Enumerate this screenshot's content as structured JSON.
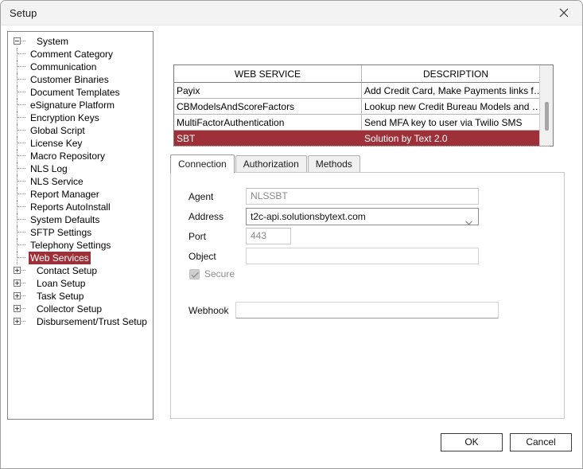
{
  "window": {
    "title": "Setup",
    "close_icon": "close-icon"
  },
  "tree": {
    "nodes": [
      {
        "label": "System",
        "level": 0,
        "expander": "minus",
        "selected": false
      },
      {
        "label": "Comment Category",
        "level": 1,
        "expander": "none",
        "selected": false
      },
      {
        "label": "Communication",
        "level": 1,
        "expander": "none",
        "selected": false
      },
      {
        "label": "Customer Binaries",
        "level": 1,
        "expander": "none",
        "selected": false
      },
      {
        "label": "Document Templates",
        "level": 1,
        "expander": "none",
        "selected": false
      },
      {
        "label": "eSignature Platform",
        "level": 1,
        "expander": "none",
        "selected": false
      },
      {
        "label": "Encryption Keys",
        "level": 1,
        "expander": "none",
        "selected": false
      },
      {
        "label": "Global Script",
        "level": 1,
        "expander": "none",
        "selected": false
      },
      {
        "label": "License Key",
        "level": 1,
        "expander": "none",
        "selected": false
      },
      {
        "label": "Macro Repository",
        "level": 1,
        "expander": "none",
        "selected": false
      },
      {
        "label": "NLS Log",
        "level": 1,
        "expander": "none",
        "selected": false
      },
      {
        "label": "NLS Service",
        "level": 1,
        "expander": "none",
        "selected": false
      },
      {
        "label": "Report Manager",
        "level": 1,
        "expander": "none",
        "selected": false
      },
      {
        "label": "Reports AutoInstall",
        "level": 1,
        "expander": "none",
        "selected": false
      },
      {
        "label": "System Defaults",
        "level": 1,
        "expander": "none",
        "selected": false
      },
      {
        "label": "SFTP Settings",
        "level": 1,
        "expander": "none",
        "selected": false
      },
      {
        "label": "Telephony Settings",
        "level": 1,
        "expander": "none",
        "selected": false
      },
      {
        "label": "Web Services",
        "level": 1,
        "expander": "none",
        "selected": true
      },
      {
        "label": "Contact Setup",
        "level": 0,
        "expander": "plus",
        "selected": false
      },
      {
        "label": "Loan Setup",
        "level": 0,
        "expander": "plus",
        "selected": false
      },
      {
        "label": "Task Setup",
        "level": 0,
        "expander": "plus",
        "selected": false
      },
      {
        "label": "Collector Setup",
        "level": 0,
        "expander": "plus",
        "selected": false
      },
      {
        "label": "Disbursement/Trust Setup",
        "level": 0,
        "expander": "plus",
        "selected": false
      }
    ]
  },
  "grid": {
    "columns": [
      "WEB SERVICE",
      "DESCRIPTION"
    ],
    "rows": [
      {
        "service": "Payix",
        "description": "Add Credit Card, Make Payments links for ...",
        "selected": false
      },
      {
        "service": "CBModelsAndScoreFactors",
        "description": "Lookup new Credit Bureau Models and Sc...",
        "selected": false
      },
      {
        "service": "MultiFactorAuthentication",
        "description": "Send MFA key to user via Twilio SMS",
        "selected": false
      },
      {
        "service": "SBT",
        "description": "Solution by Text 2.0",
        "selected": true
      }
    ],
    "scrollbar": "vertical-scrollbar"
  },
  "tabs": [
    {
      "label": "Connection",
      "active": true
    },
    {
      "label": "Authorization",
      "active": false
    },
    {
      "label": "Methods",
      "active": false
    }
  ],
  "connection_form": {
    "agent_label": "Agent",
    "agent_value": "NLSSBT",
    "address_label": "Address",
    "address_value": "t2c-api.solutionsbytext.com",
    "port_label": "Port",
    "port_value": "443",
    "object_label": "Object",
    "object_value": "",
    "secure_label": "Secure",
    "secure_checked": true,
    "webhook_label": "Webhook",
    "webhook_value": ""
  },
  "footer": {
    "ok_label": "OK",
    "cancel_label": "Cancel"
  },
  "colors": {
    "selection": "#9d3039",
    "titlebar": "#f3f3f3"
  }
}
